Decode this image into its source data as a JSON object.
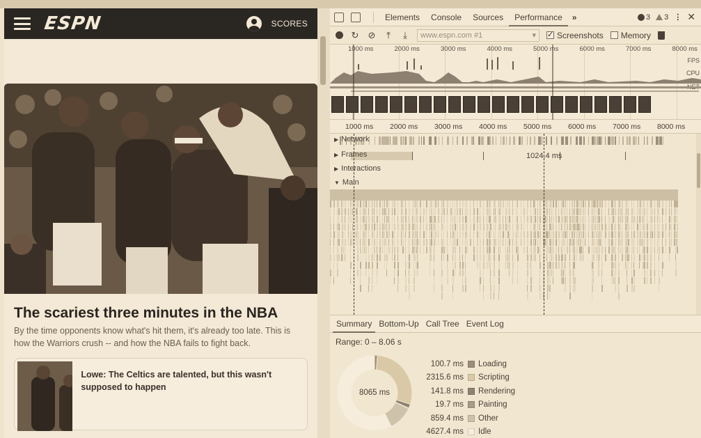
{
  "espn": {
    "logo": "ESPN",
    "scores_label": "SCORES",
    "headline": "The scariest three minutes in the NBA",
    "dek": "By the time opponents know what's hit them, it's already too late. This is how the Warriors crush -- and how the NBA fails to fight back.",
    "card_title": "Lowe: The Celtics are talented, but this wasn't supposed to happen"
  },
  "devtools": {
    "tabs": [
      "Elements",
      "Console",
      "Sources",
      "Performance"
    ],
    "more_tabs": "»",
    "errors": "3",
    "warnings": "3",
    "url_placeholder": "www.espn.com #1",
    "screenshots_label": "Screenshots",
    "memory_label": "Memory",
    "overview_ticks": [
      "1000 ms",
      "2000 ms",
      "3000 ms",
      "4000 ms",
      "5000 ms",
      "6000 ms",
      "7000 ms",
      "8000 ms"
    ],
    "lane_labels": [
      "FPS",
      "CPU",
      "NET"
    ],
    "flame_ticks": [
      "1000 ms",
      "2000 ms",
      "3000 ms",
      "4000 ms",
      "5000 ms",
      "6000 ms",
      "7000 ms",
      "8000 ms"
    ],
    "tracks": {
      "network": "Network",
      "frames": "Frames",
      "interactions": "Interactions",
      "main": "Main"
    },
    "frames_value": "1024.4 ms",
    "summary_tabs": [
      "Summary",
      "Bottom-Up",
      "Call Tree",
      "Event Log"
    ],
    "range": "Range: 0 – 8.06 s",
    "total": "8065 ms",
    "breakdown": [
      {
        "value": "100.7 ms",
        "label": "Loading",
        "ms": 100.7,
        "color": "#9c8e7a"
      },
      {
        "value": "2315.6 ms",
        "label": "Scripting",
        "ms": 2315.6,
        "color": "#d9c9a6"
      },
      {
        "value": "141.8 ms",
        "label": "Rendering",
        "ms": 141.8,
        "color": "#8f8270"
      },
      {
        "value": "19.7 ms",
        "label": "Painting",
        "ms": 19.7,
        "color": "#a99c86"
      },
      {
        "value": "859.4 ms",
        "label": "Other",
        "ms": 859.4,
        "color": "#cfc2aa"
      },
      {
        "value": "4627.4 ms",
        "label": "Idle",
        "ms": 4627.4,
        "color": "#f6eddd"
      }
    ]
  }
}
